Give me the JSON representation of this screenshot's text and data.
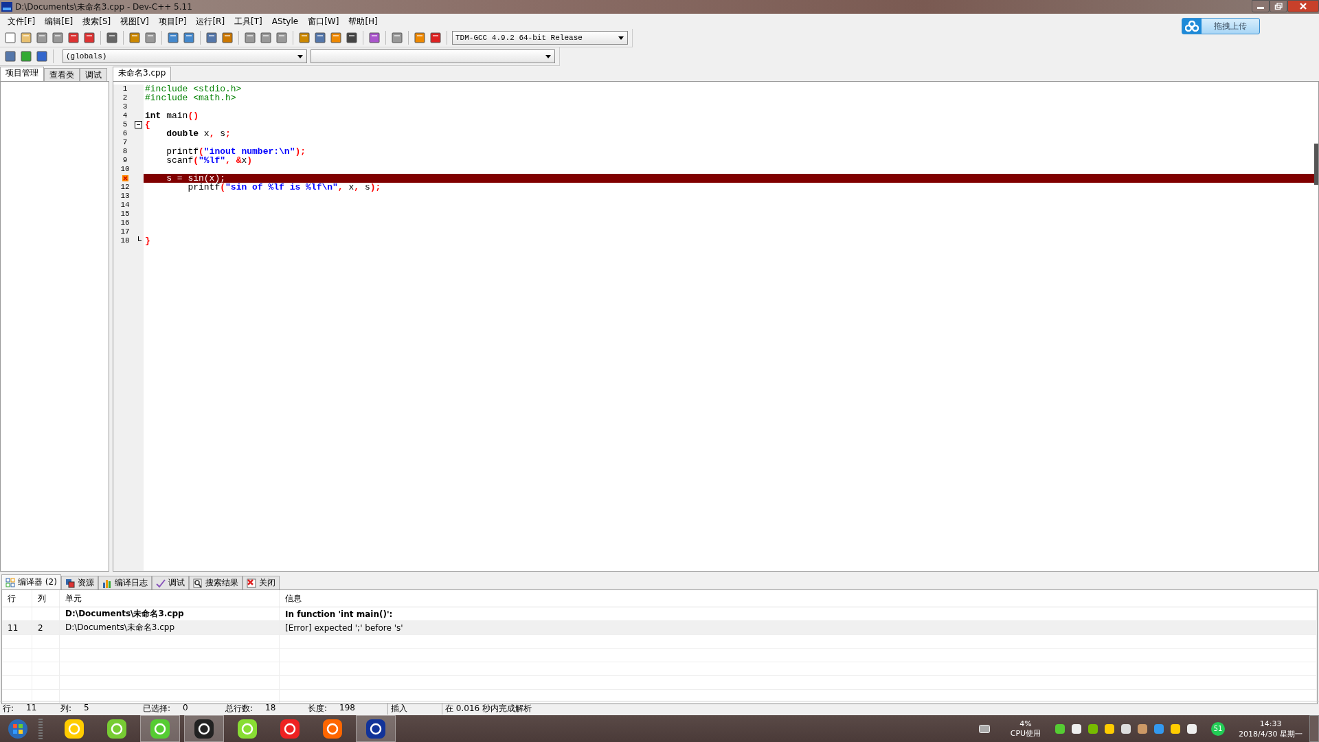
{
  "window": {
    "title": "D:\\Documents\\未命名3.cpp - Dev-C++ 5.11"
  },
  "menu": [
    "文件[F]",
    "编辑[E]",
    "搜索[S]",
    "视图[V]",
    "项目[P]",
    "运行[R]",
    "工具[T]",
    "AStyle",
    "窗口[W]",
    "帮助[H]"
  ],
  "compiler_select": {
    "value": "TDM-GCC 4.9.2 64-bit Release"
  },
  "scope_select": {
    "value": "(globals)"
  },
  "upload_button": {
    "label": "拖拽上传"
  },
  "side_tabs": [
    {
      "label": "项目管理",
      "selected": true
    },
    {
      "label": "查看类",
      "selected": false
    },
    {
      "label": "调试",
      "selected": false
    }
  ],
  "editor_tabs": [
    {
      "label": "未命名3.cpp",
      "selected": true
    }
  ],
  "code": [
    {
      "number": "1",
      "tokens": [
        {
          "kind": "pre",
          "text": "#include <stdio.h>"
        }
      ]
    },
    {
      "number": "2",
      "tokens": [
        {
          "kind": "pre",
          "text": "#include <math.h>"
        }
      ]
    },
    {
      "number": "3"
    },
    {
      "number": "4",
      "tokens": [
        {
          "kind": "kw",
          "text": "int"
        },
        {
          "kind": "plain",
          "text": " main"
        },
        {
          "kind": "sym",
          "text": "()"
        }
      ]
    },
    {
      "number": "5",
      "kind": "fold_start",
      "tokens": [
        {
          "kind": "sym",
          "text": "{"
        }
      ]
    },
    {
      "number": "6",
      "tokens": [
        {
          "kind": "kw",
          "text": "    double"
        },
        {
          "kind": "plain",
          "text": " x"
        },
        {
          "kind": "sym",
          "text": ","
        },
        {
          "kind": "plain",
          "text": " s"
        },
        {
          "kind": "sym",
          "text": ";"
        }
      ]
    },
    {
      "number": "7"
    },
    {
      "number": "8",
      "tokens": [
        {
          "kind": "plain",
          "text": "    printf"
        },
        {
          "kind": "sym",
          "text": "("
        },
        {
          "kind": "str",
          "text": "\"inout number:\\n\""
        },
        {
          "kind": "sym",
          "text": ");"
        }
      ]
    },
    {
      "number": "9",
      "tokens": [
        {
          "kind": "plain",
          "text": "    scanf"
        },
        {
          "kind": "sym",
          "text": "("
        },
        {
          "kind": "str",
          "text": "\"%lf\""
        },
        {
          "kind": "sym",
          "text": ", &"
        },
        {
          "kind": "plain",
          "text": "x"
        },
        {
          "kind": "sym",
          "text": ")"
        }
      ]
    },
    {
      "number": "10"
    },
    {
      "kind": "error",
      "tokens": [
        {
          "kind": "plain",
          "text": "    s = sin(x);"
        }
      ]
    },
    {
      "number": "12",
      "tokens": [
        {
          "kind": "plain",
          "text": "        printf"
        },
        {
          "kind": "sym",
          "text": "("
        },
        {
          "kind": "str",
          "text": "\"sin of %lf is %lf\\n\""
        },
        {
          "kind": "sym",
          "text": ","
        },
        {
          "kind": "plain",
          "text": " x"
        },
        {
          "kind": "sym",
          "text": ","
        },
        {
          "kind": "plain",
          "text": " s"
        },
        {
          "kind": "sym",
          "text": ");"
        }
      ]
    },
    {
      "number": "13"
    },
    {
      "number": "14"
    },
    {
      "number": "15"
    },
    {
      "number": "16"
    },
    {
      "number": "17"
    },
    {
      "number": "18",
      "kind": "fold_end",
      "tokens": [
        {
          "kind": "sym",
          "text": "}"
        }
      ]
    }
  ],
  "bottom_tabs": [
    {
      "label": "编译器 (2)",
      "selected": true
    },
    {
      "label": "资源",
      "selected": false
    },
    {
      "label": "编译日志",
      "selected": false
    },
    {
      "label": "调试",
      "selected": false
    },
    {
      "label": "搜索结果",
      "selected": false
    },
    {
      "label": "关闭",
      "selected": false
    }
  ],
  "messages": {
    "columns": [
      "行",
      "列",
      "单元",
      "信息"
    ],
    "rows": [
      {
        "kind": "header",
        "unit": "D:\\Documents\\未命名3.cpp",
        "message": "In function 'int main()':",
        "selected": false
      },
      {
        "kind": "error",
        "line": "11",
        "col": "2",
        "unit": "D:\\Documents\\未命名3.cpp",
        "message": "[Error] expected ';' before 's'",
        "selected": true
      }
    ]
  },
  "status_bar": [
    {
      "label": "行:",
      "value": "11"
    },
    {
      "label": "列:",
      "value": "5"
    },
    {
      "label": "已选择:",
      "value": "0"
    },
    {
      "label": "总行数:",
      "value": "18"
    },
    {
      "label": "长度:",
      "value": "198"
    }
  ],
  "status_mode": "插入",
  "status_message": "在 0.016 秒内完成解析",
  "tray": {
    "cpu_percent": "4%",
    "cpu_label": "CPU使用",
    "badge": "51",
    "time": "14:33",
    "date": "2018/4/30 星期一"
  }
}
